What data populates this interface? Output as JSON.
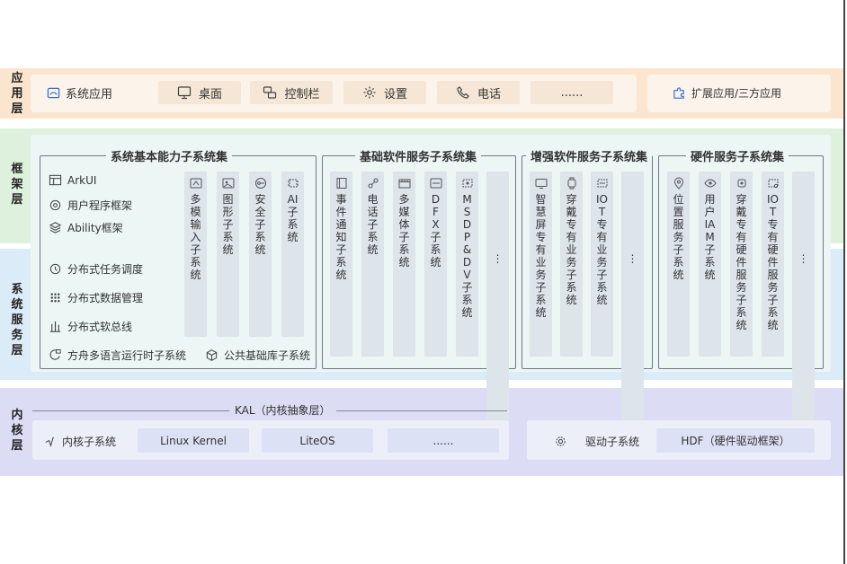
{
  "layers": {
    "application": "应用层",
    "framework": "框架层",
    "system_services": "系统服务层",
    "kernel": "内核层"
  },
  "app_layer": {
    "system_apps_label": "系统应用",
    "tabs": [
      "桌面",
      "控制栏",
      "设置",
      "电话",
      "......"
    ],
    "extension_label": "扩展应用/三方应用"
  },
  "framework": {
    "basic_group": {
      "title": "系统基本能力子系统集",
      "items": [
        "ArkUI",
        "用户程序框架",
        "Ability框架",
        "分布式任务调度",
        "分布式数据管理",
        "分布式软总线",
        "方舟多语言运行时子系统",
        "公共基础库子系统"
      ],
      "columns": [
        "多模输入子系统",
        "图形子系统",
        "安全子系统",
        "AI子系统"
      ]
    },
    "base_software_group": {
      "title": "基础软件服务子系统集",
      "columns": [
        "事件通知子系统",
        "电话子系统",
        "多媒体子系统",
        "DFX子系统",
        "MSDP&DV子系统",
        "⋮"
      ]
    },
    "enhanced_group": {
      "title": "增强软件服务子系统集",
      "columns": [
        "智慧屏专有业务子系统",
        "穿戴专有业务子系统",
        "IOT专有业务子系统",
        "⋮"
      ]
    },
    "hardware_group": {
      "title": "硬件服务子系统集",
      "columns": [
        "位置服务子系统",
        "用户IAM子系统",
        "穿戴专有硬件服务子系统",
        "IOT专有硬件服务子系统",
        "⋮"
      ]
    }
  },
  "kernel_layer": {
    "kal_label": "KAL（内核抽象层）",
    "kernel_subsystem_label": "内核子系统",
    "kernels": [
      "Linux Kernel",
      "LiteOS",
      "......"
    ],
    "driver_subsystem_label": "驱动子系统",
    "hdf_label": "HDF（硬件驱动框架）"
  },
  "colors": {
    "app_band": "#fbe5cf",
    "framework_band": "#ddf1dc",
    "system_band": "#dcebf8",
    "kernel_band": "#dcdcf5",
    "column_fill": "#dde4ea"
  }
}
